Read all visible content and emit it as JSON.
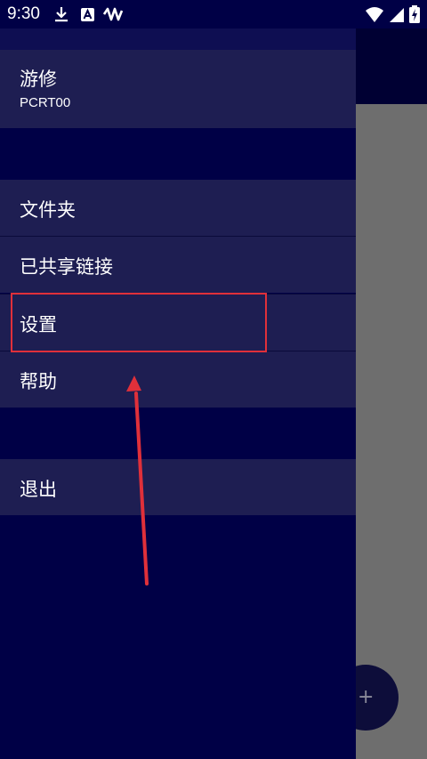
{
  "status_bar": {
    "time": "9:30",
    "icons": [
      "download-icon",
      "a-badge-icon",
      "activity-icon",
      "wifi-icon",
      "cell-signal-icon",
      "battery-charging-icon"
    ]
  },
  "drawer": {
    "account_name": "游修",
    "account_id": "PCRT00",
    "items": [
      {
        "label": "文件夹"
      },
      {
        "label": "已共享链接"
      },
      {
        "label": "设置"
      },
      {
        "label": "帮助"
      }
    ],
    "logout_label": "退出"
  },
  "fab": {
    "icon": "plus-icon",
    "glyph": "+"
  },
  "annotation": {
    "highlight_color": "#e0303a",
    "arrow_color": "#e0303a",
    "target": "设置"
  },
  "colors": {
    "background": "#000046",
    "drawer_item": "#1e1e52",
    "scrim": "#6e6e6e"
  }
}
